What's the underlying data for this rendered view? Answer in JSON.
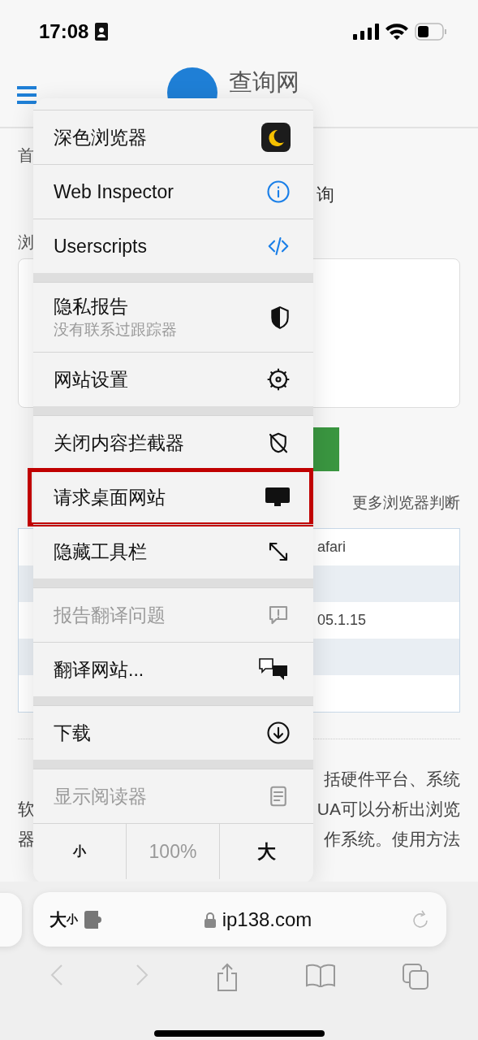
{
  "status_bar": {
    "time": "17:08"
  },
  "page": {
    "site_name": "查询网",
    "breadcrumb_fragment": "首",
    "title_fragment": "询",
    "label_fragment": "浏",
    "more_link": "更多浏览器判断",
    "table_rows": [
      {
        "value": "afari",
        "shaded": false
      },
      {
        "shaded": true
      },
      {
        "value": "05.1.15",
        "shaded": false
      },
      {
        "shaded": true
      },
      {
        "shaded": false
      }
    ],
    "paragraph_lines": [
      {
        "right": "括硬件平台、系统"
      },
      {
        "left": "软",
        "right": "UA可以分析出浏览"
      },
      {
        "left": "器",
        "right": "作系统。使用方法"
      }
    ]
  },
  "menu": {
    "groups": [
      [
        {
          "label": "深色浏览器",
          "disabled": false,
          "highlighted": false
        },
        {
          "label": "Web Inspector",
          "disabled": false,
          "highlighted": false
        },
        {
          "label": "Userscripts",
          "disabled": false,
          "highlighted": false
        }
      ],
      [
        {
          "label": "隐私报告",
          "subtitle": "没有联系过跟踪器",
          "disabled": false,
          "highlighted": false
        },
        {
          "label": "网站设置",
          "disabled": false,
          "highlighted": false
        }
      ],
      [
        {
          "label": "关闭内容拦截器",
          "disabled": false,
          "highlighted": false
        },
        {
          "label": "请求桌面网站",
          "disabled": false,
          "highlighted": true
        },
        {
          "label": "隐藏工具栏",
          "disabled": false,
          "highlighted": false
        }
      ],
      [
        {
          "label": "报告翻译问题",
          "disabled": true,
          "highlighted": false
        },
        {
          "label": "翻译网站...",
          "disabled": false,
          "highlighted": false
        }
      ],
      [
        {
          "label": "下载",
          "disabled": false,
          "highlighted": false
        }
      ],
      [
        {
          "label": "显示阅读器",
          "disabled": true,
          "highlighted": false
        }
      ]
    ],
    "zoom": {
      "smaller": "小",
      "level": "100%",
      "larger": "大"
    }
  },
  "address_bar": {
    "size_big": "大",
    "size_small": "小",
    "url": "ip138.com"
  }
}
